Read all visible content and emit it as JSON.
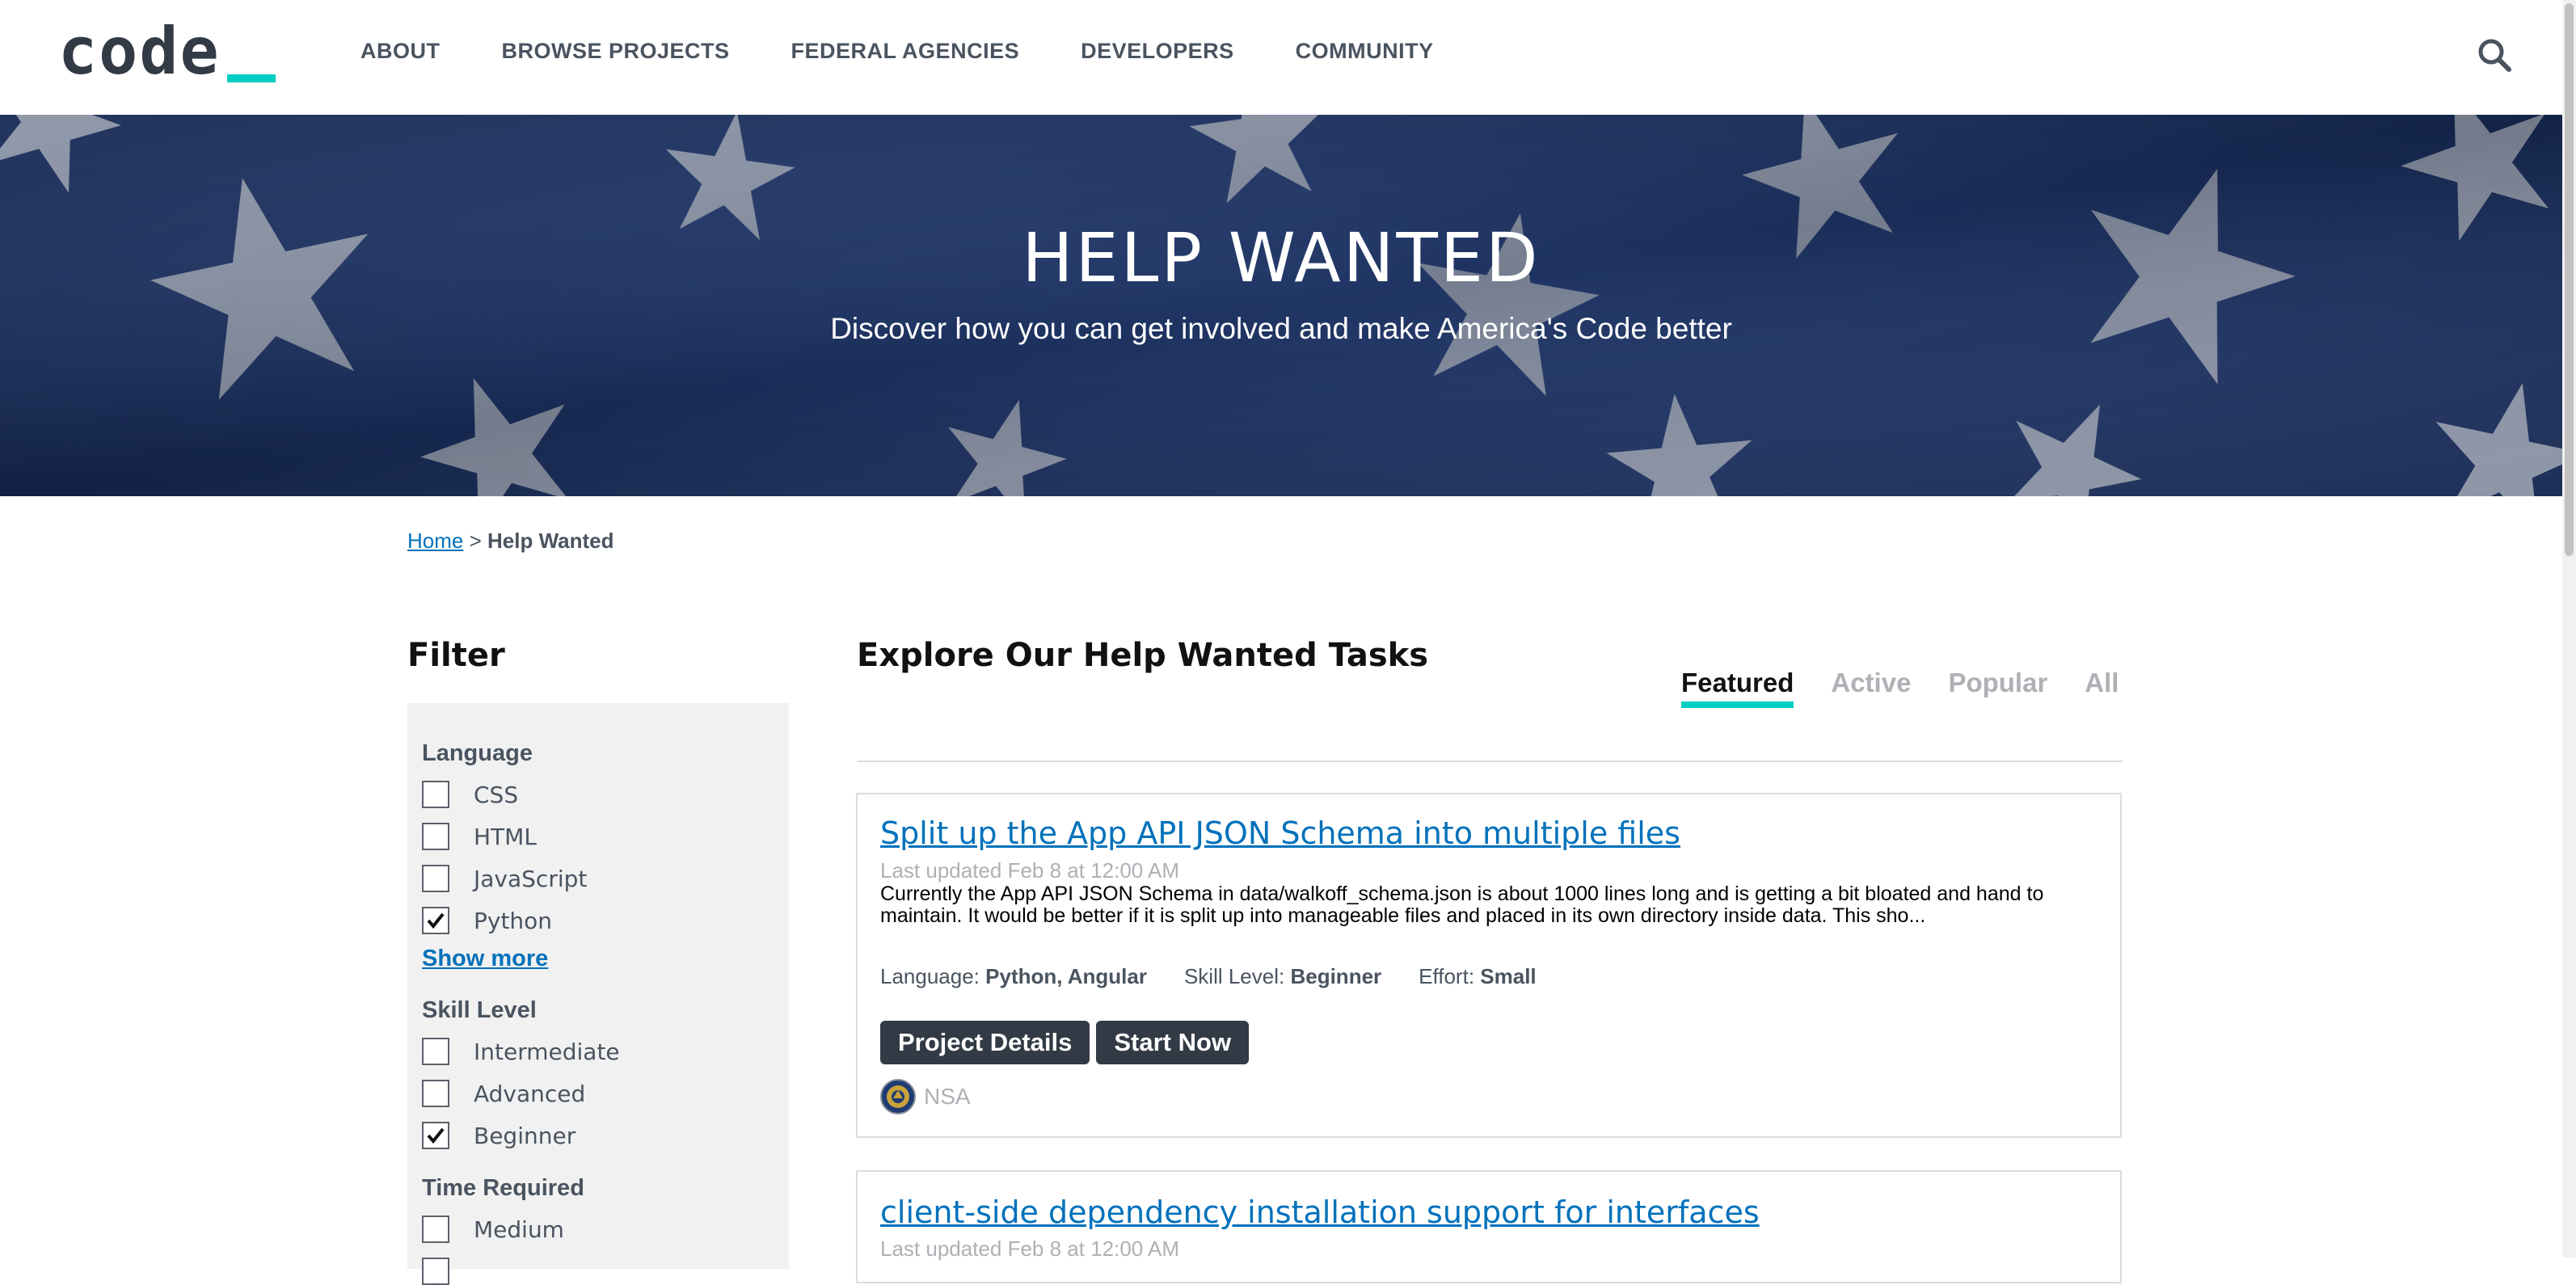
{
  "header": {
    "logo_text": "code",
    "nav": [
      "ABOUT",
      "BROWSE PROJECTS",
      "FEDERAL AGENCIES",
      "DEVELOPERS",
      "COMMUNITY"
    ],
    "search_icon": "search-icon"
  },
  "hero": {
    "title": "HELP WANTED",
    "subtitle": "Discover how you can get involved and make America's Code better"
  },
  "breadcrumb": {
    "home": "Home",
    "separator": ">",
    "current": "Help Wanted"
  },
  "filter": {
    "title": "Filter",
    "language": {
      "label": "Language",
      "options": [
        {
          "label": "CSS",
          "checked": false
        },
        {
          "label": "HTML",
          "checked": false
        },
        {
          "label": "JavaScript",
          "checked": false
        },
        {
          "label": "Python",
          "checked": true
        }
      ],
      "show_more": "Show more"
    },
    "skill": {
      "label": "Skill Level",
      "options": [
        {
          "label": "Intermediate",
          "checked": false
        },
        {
          "label": "Advanced",
          "checked": false
        },
        {
          "label": "Beginner",
          "checked": true
        }
      ]
    },
    "time": {
      "label": "Time Required",
      "options": [
        {
          "label": "Medium",
          "checked": false
        }
      ]
    }
  },
  "main": {
    "title": "Explore Our Help Wanted Tasks",
    "tabs": [
      {
        "label": "Featured",
        "active": true
      },
      {
        "label": "Active",
        "active": false
      },
      {
        "label": "Popular",
        "active": false
      },
      {
        "label": "All",
        "active": false
      }
    ],
    "tasks": [
      {
        "title": "Split up the App API JSON Schema into multiple files",
        "updated": "Last updated Feb 8 at 12:00 AM",
        "description": "Currently the App API JSON Schema in data/walkoff_schema.json is about 1000 lines long and is getting a bit bloated and hand to maintain. It would be better if it is split up into manageable files and placed in its own directory inside data. This sho...",
        "language_label": "Language:",
        "language": "Python, Angular",
        "skill_label": "Skill Level:",
        "skill": "Beginner",
        "effort_label": "Effort:",
        "effort": "Small",
        "details_button": "Project Details",
        "start_button": "Start Now",
        "agency": "NSA"
      },
      {
        "title": "client-side dependency installation support for interfaces",
        "updated": "Last updated Feb 8 at 12:00 AM"
      }
    ]
  },
  "colors": {
    "accent": "#00cfc1",
    "link": "#0071bb",
    "dark": "#323a45",
    "muted": "#aeb0b5"
  }
}
